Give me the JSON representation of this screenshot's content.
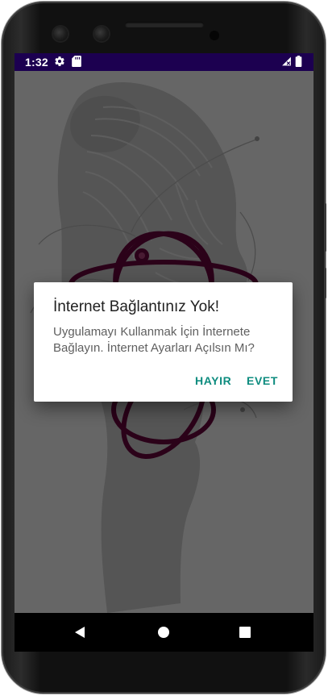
{
  "status_bar": {
    "time": "1:32",
    "icons": [
      "settings-gear-icon",
      "sd-card-icon",
      "signal-no-data-icon",
      "battery-icon"
    ]
  },
  "dialog": {
    "title": "İnternet Bağlantınız Yok!",
    "message": "Uygulamayı Kullanmak İçin İnternete Bağlayın. İnternet Ayarları Açılsın Mı?",
    "negative_button": "HAYIR",
    "positive_button": "EVET"
  },
  "navigation_bar": {
    "buttons": [
      "back-icon",
      "home-icon",
      "recents-icon"
    ]
  },
  "colors": {
    "status_bar": "#1c0050",
    "accent": "#0e8c7f",
    "logo_ring": "#6b0640"
  }
}
